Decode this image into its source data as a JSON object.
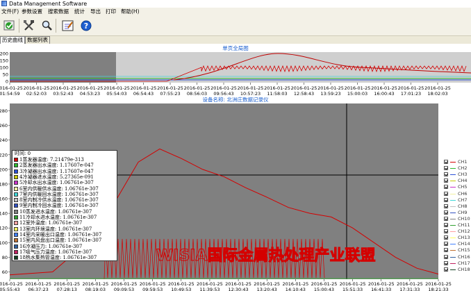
{
  "window": {
    "title": "Data Management Software"
  },
  "menu": [
    "文件(F)",
    "参数设置",
    "搜索数据",
    "统计",
    "导出",
    "打印",
    "帮助(H)"
  ],
  "toolbar": [
    {
      "icon": "check-icon",
      "label": "确认"
    },
    {
      "icon": "tools-icon",
      "label": "工具"
    },
    {
      "icon": "search-icon",
      "label": "查找"
    },
    {
      "icon": "edit-icon",
      "label": "编辑"
    },
    {
      "icon": "help-icon",
      "label": "帮助"
    }
  ],
  "tabs": [
    {
      "label": "历史曲线",
      "active": true
    },
    {
      "label": "数据列表",
      "active": false
    }
  ],
  "overview": {
    "title": "单页全局图",
    "y_ticks": [
      "200",
      "150",
      "100",
      "50",
      "0"
    ],
    "x_dates": [
      "2016-01-25",
      "2016-01-25",
      "2016-01-25",
      "2016-01-25",
      "2016-01-25",
      "2016-01-25",
      "2016-01-25",
      "2016-01-25",
      "2016-01-25",
      "2016-01-25",
      "2016-01-25",
      "2016-01-25",
      "2016-01-25",
      "2016-01-25"
    ],
    "x_times": [
      "01:54:59",
      "02:52:03",
      "03:52:43",
      "04:53:23",
      "05:54:03",
      "06:54:43",
      "07:55:23",
      "08:56:03",
      "09:56:43",
      "10:57:23",
      "11:58:03",
      "12:58:43",
      "13:59:23",
      "15:00:03",
      "16:00:43",
      "17:01:23",
      "18:02:03"
    ]
  },
  "main": {
    "title": "设备名称:  北洲庄数据记录仪",
    "y_ticks": [
      "280",
      "260",
      "240",
      "220",
      "200",
      "180",
      "160",
      "140",
      "120",
      "100",
      "80",
      "60"
    ],
    "x_dates": [
      "2016-01-25",
      "2016-01-25",
      "2016-01-25",
      "2016-01-25",
      "2016-01-25",
      "2016-01-25",
      "2016-01-25",
      "2016-01-25",
      "2016-01-25",
      "2016-01-25",
      "2016-01-25",
      "2016-01-25",
      "2016-01-25",
      "2016-01-25",
      "2016-01-25"
    ],
    "x_times": [
      "05:55:43",
      "06:37:23",
      "07:28:13",
      "08:19:03",
      "09:09:53",
      "09:59:53",
      "10:49:53",
      "11:39:53",
      "12:30:43",
      "13:20:43",
      "14:10:43",
      "15:00:43",
      "15:51:33",
      "16:41:33",
      "17:31:33",
      "18:21:33"
    ],
    "watermark": "WISIA国际金属热处理产业联盟"
  },
  "readout": {
    "title": "时间:  0",
    "rows": [
      {
        "label": "1蒸发器温度: 7.21479e-313",
        "color": "#d40000"
      },
      {
        "label": "2蒸发器出水温度: 1.17607e-047",
        "color": "#2db82d"
      },
      {
        "label": "3冷凝器出水温度: 1.17607e-047",
        "color": "#2b4fd8"
      },
      {
        "label": "4冷凝器进水温度: 5.27365e-091",
        "color": "#c8c800"
      },
      {
        "label": "5冷却水出水温度: 1.06761e-307",
        "color": "#c832c8"
      },
      {
        "label": "6室内供暖供水温度: 1.06761e-307",
        "color": "#f0f0a0"
      },
      {
        "label": "7室内供暖回水温度: 1.06761e-307",
        "color": "#40d8d8"
      },
      {
        "label": "8室内制冷供水温度: 1.06761e-307",
        "color": "#c0c0c0"
      },
      {
        "label": "9室内制冷回水温度: 1.06761e-307",
        "color": "#3050c0"
      },
      {
        "label": "10蒸发进水温度: 1.06761e-307",
        "color": "#808080"
      },
      {
        "label": "11冷却水进水温度: 1.06761e-307",
        "color": "#30a030"
      },
      {
        "label": "12室外温度: 1.06761e-307",
        "color": "#ffa0a0"
      },
      {
        "label": "13室内环境温度: 1.06761e-307",
        "color": "#ffff60"
      },
      {
        "label": "14室内采暖出口温度: 1.06761e-307",
        "color": "#4080ff"
      },
      {
        "label": "15室内风盘出口温度: 1.06761e-307",
        "color": "#c07030"
      },
      {
        "label": "16冷凝压力: 1.06761e-307",
        "color": "#3060a0"
      },
      {
        "label": "17吸气压力温度: 1.06761e-307",
        "color": "#c02060"
      },
      {
        "label": "18热水集热管温度: 1.06761e-307",
        "color": "#104020"
      }
    ]
  },
  "channels": [
    {
      "name": "CH1",
      "color": "#d40000",
      "checked": true
    },
    {
      "name": "CH2",
      "color": "#2db82d",
      "checked": true
    },
    {
      "name": "CH3",
      "color": "#2b4fd8",
      "checked": true
    },
    {
      "name": "CH4",
      "color": "#c8c800",
      "checked": true
    },
    {
      "name": "CH5",
      "color": "#c832c8",
      "checked": true
    },
    {
      "name": "CH6",
      "color": "#f0f0a0",
      "checked": true
    },
    {
      "name": "CH7",
      "color": "#40d8d8",
      "checked": true
    },
    {
      "name": "CH8",
      "color": "#c0c0c0",
      "checked": true
    },
    {
      "name": "CH9",
      "color": "#3050c0",
      "checked": true
    },
    {
      "name": "CH10",
      "color": "#808080",
      "checked": true
    },
    {
      "name": "CH11",
      "color": "#30a030",
      "checked": true
    },
    {
      "name": "CH12",
      "color": "#ffa0a0",
      "checked": true
    },
    {
      "name": "CH13",
      "color": "#ffff60",
      "checked": true
    },
    {
      "name": "CH14",
      "color": "#4080ff",
      "checked": true
    },
    {
      "name": "CH15",
      "color": "#c07030",
      "checked": true
    },
    {
      "name": "CH16",
      "color": "#3060a0",
      "checked": true
    },
    {
      "name": "CH17",
      "color": "#c02060",
      "checked": true
    },
    {
      "name": "CH18",
      "color": "#104020",
      "checked": true
    }
  ],
  "chart_data": {
    "type": "line",
    "title": "设备名称:  北洲庄数据记录仪",
    "ylim": [
      50,
      290
    ],
    "series": [
      {
        "name": "CH1",
        "color": "#d40000",
        "x": [
          0,
          0.1,
          0.2,
          0.25,
          0.3,
          0.35,
          0.4,
          0.45,
          0.5,
          0.55,
          0.6,
          0.65,
          0.7,
          0.75,
          0.8,
          0.85,
          0.9,
          0.95,
          1.0
        ],
        "values": [
          56,
          60,
          110,
          160,
          210,
          228,
          215,
          200,
          190,
          175,
          162,
          148,
          140,
          135,
          120,
          100,
          80,
          65,
          57
        ]
      }
    ]
  }
}
